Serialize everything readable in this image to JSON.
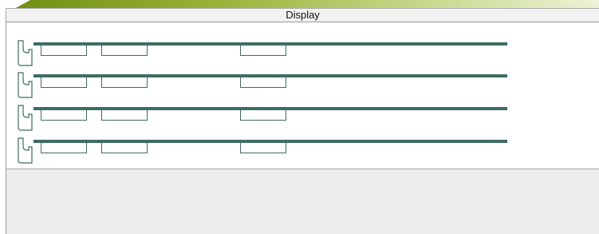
{
  "window": {
    "title": "Display"
  },
  "colors": {
    "banner_gradient": [
      "#6f8f14",
      "#9bb23a",
      "#c9d88c",
      "#edf2d6"
    ],
    "track": "#3e6b62",
    "panel_bg": "#ececec"
  },
  "rows": [
    {
      "slots": 3
    },
    {
      "slots": 3
    },
    {
      "slots": 3
    },
    {
      "slots": 3
    }
  ]
}
